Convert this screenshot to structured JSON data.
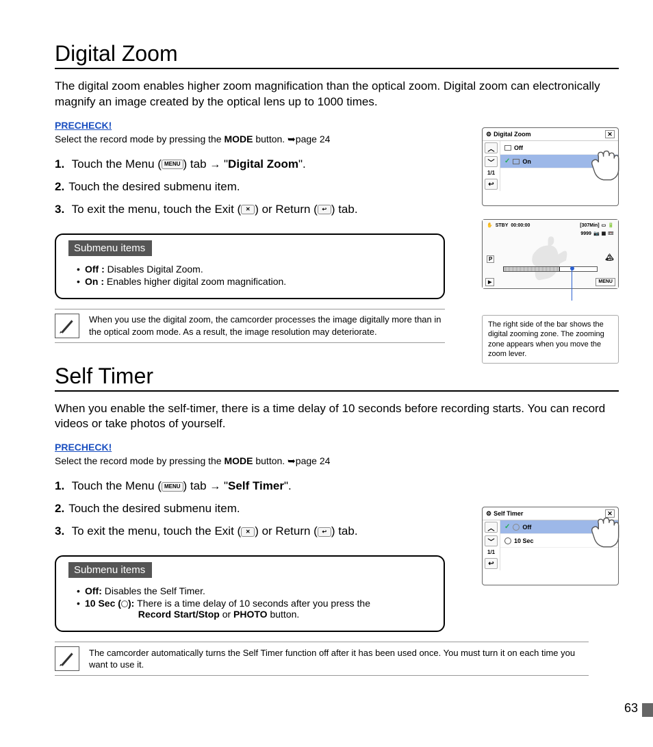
{
  "page_number": "63",
  "section1": {
    "heading": "Digital Zoom",
    "intro": "The digital zoom enables higher zoom magnification than the optical zoom. Digital zoom can electronically magnify an image created by the optical lens up to 1000 times.",
    "precheck_label": "PRECHECK!",
    "precheck_text_pre": "Select the record mode by pressing the ",
    "precheck_bold": "MODE",
    "precheck_text_post": " button. ➥page 24",
    "steps": {
      "s1_pre": "Touch the Menu (",
      "s1_icon": "MENU",
      "s1_mid": ") tab ",
      "s1_arrow": "→",
      "s1_quote_open": " \"",
      "s1_bold": "Digital Zoom",
      "s1_quote_close": "\".",
      "s2": "Touch the desired submenu item.",
      "s3_pre": "To exit the menu, touch the Exit (",
      "s3_icon1": "✕",
      "s3_mid": ") or Return (",
      "s3_icon2": "↩",
      "s3_post": ") tab."
    },
    "submenu_title": "Submenu items",
    "submenu": {
      "i1_b": "Off :",
      "i1_t": " Disables Digital Zoom.",
      "i2_b": "On :",
      "i2_t": " Enables higher digital zoom magnification."
    },
    "note": "When you use the digital zoom, the camcorder processes the image digitally more than in the optical zoom mode. As a result, the image resolution may deteriorate.",
    "lcd1": {
      "title": "Digital Zoom",
      "off": "Off",
      "on": "On",
      "page": "1/1"
    },
    "lcd2": {
      "stby": "STBY",
      "time": "00:00:00",
      "remain": "[307Min]",
      "count": "9999",
      "menu": "MENU"
    },
    "caption": "The right side of the bar shows the digital zooming zone. The zooming zone appears when you move the zoom lever."
  },
  "section2": {
    "heading": "Self Timer",
    "intro": "When you enable the self-timer, there is a time delay of 10 seconds before recording starts. You can record videos or take photos of yourself.",
    "precheck_label": "PRECHECK!",
    "precheck_text_pre": "Select the record mode by pressing the ",
    "precheck_bold": "MODE",
    "precheck_text_post": " button. ➥page 24",
    "steps": {
      "s1_pre": "Touch the Menu (",
      "s1_icon": "MENU",
      "s1_mid": ") tab ",
      "s1_arrow": "→",
      "s1_quote_open": " \"",
      "s1_bold": "Self Timer",
      "s1_quote_close": "\".",
      "s2": "Touch the desired submenu item.",
      "s3_pre": "To exit the menu, touch the Exit (",
      "s3_icon1": "✕",
      "s3_mid": ") or Return (",
      "s3_icon2": "↩",
      "s3_post": ") tab."
    },
    "submenu_title": "Submenu items",
    "submenu": {
      "i1_b": "Off:",
      "i1_t": " Disables the Self Timer.",
      "i2_b": "10 Sec (",
      "i2_t": "): ",
      "i2_desc": "There is a time delay of 10 seconds after you press the ",
      "i2_bold1": "Record Start/Stop",
      "i2_or": " or ",
      "i2_bold2": "PHOTO",
      "i2_end": " button."
    },
    "note": "The camcorder automatically turns the Self Timer function off after it has been used once. You must turn it on each time you want to use it.",
    "lcd": {
      "title": "Self Timer",
      "off": "Off",
      "ten": "10 Sec",
      "page": "1/1"
    }
  }
}
